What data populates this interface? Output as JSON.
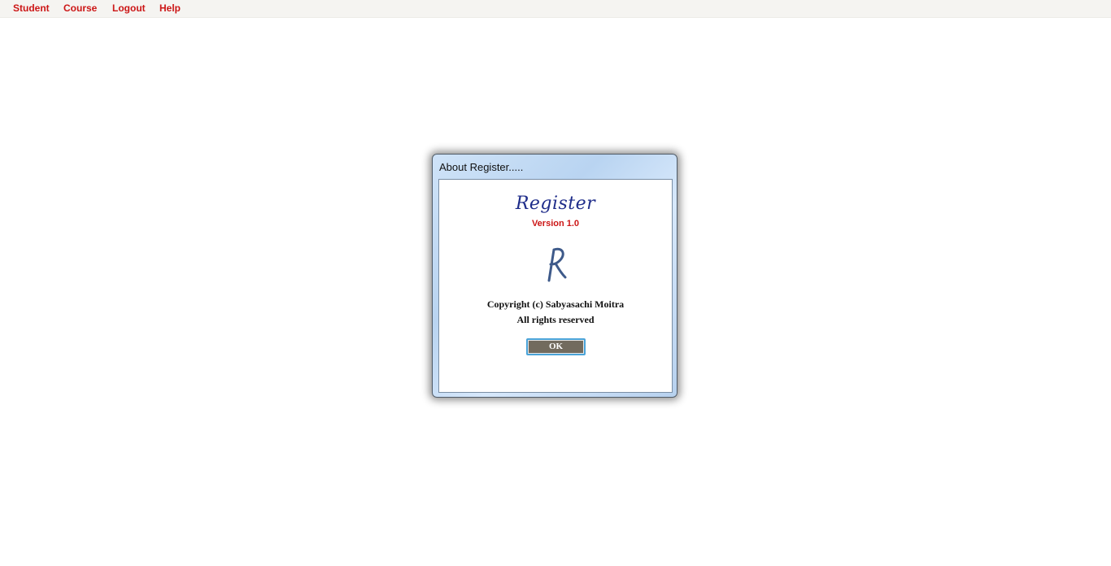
{
  "menubar": {
    "items": [
      {
        "label": "Student"
      },
      {
        "label": "Course"
      },
      {
        "label": "Logout"
      },
      {
        "label": "Help"
      }
    ]
  },
  "dialog": {
    "title": "About Register.....",
    "app_name": "Register",
    "version": "Version 1.0",
    "logo_icon": "register-logo-icon",
    "copyright": "Copyright (c) Sabyasachi Moitra",
    "rights": "All rights reserved",
    "ok_label": "OK"
  },
  "colors": {
    "menu_text": "#cc1616",
    "version_text": "#cc1616",
    "app_name_text": "#1f2d8a",
    "logo": "#3e5a8a",
    "ok_button_bg": "#726b5e",
    "ok_button_border": "#4aa3d8"
  }
}
